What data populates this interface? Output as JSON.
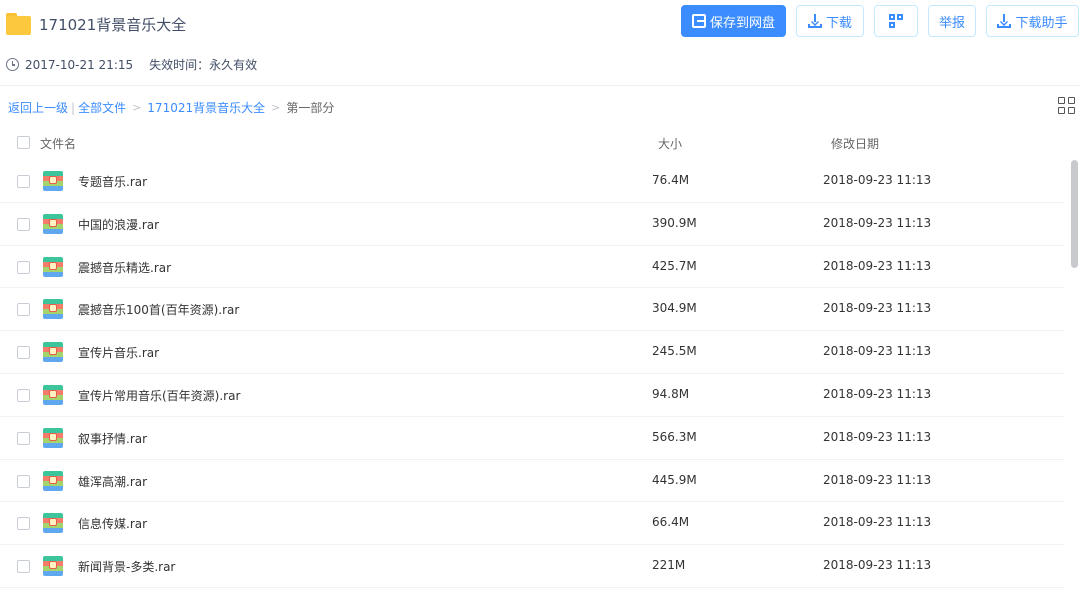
{
  "header": {
    "title": "171021背景音乐大全",
    "created_time": "2017-10-21 21:15",
    "expiry_label": "失效时间：永久有效",
    "buttons": {
      "save": "保存到网盘",
      "download": "下载",
      "report": "举报",
      "helper": "下载助手"
    },
    "accent_color": "#3b8cff"
  },
  "breadcrumb": {
    "back": "返回上一级",
    "separator": "|",
    "items": [
      "全部文件",
      "171021背景音乐大全"
    ],
    "current": "第一部分"
  },
  "table": {
    "columns": [
      "文件名",
      "大小",
      "修改日期"
    ],
    "rows": [
      {
        "name": "专题音乐.rar",
        "size": "76.4M",
        "date": "2018-09-23 11:13"
      },
      {
        "name": "中国的浪漫.rar",
        "size": "390.9M",
        "date": "2018-09-23 11:13"
      },
      {
        "name": "震撼音乐精选.rar",
        "size": "425.7M",
        "date": "2018-09-23 11:13"
      },
      {
        "name": "震撼音乐100首(百年资源).rar",
        "size": "304.9M",
        "date": "2018-09-23 11:13"
      },
      {
        "name": "宣传片音乐.rar",
        "size": "245.5M",
        "date": "2018-09-23 11:13"
      },
      {
        "name": "宣传片常用音乐(百年资源).rar",
        "size": "94.8M",
        "date": "2018-09-23 11:13"
      },
      {
        "name": "叙事抒情.rar",
        "size": "566.3M",
        "date": "2018-09-23 11:13"
      },
      {
        "name": "雄浑高潮.rar",
        "size": "445.9M",
        "date": "2018-09-23 11:13"
      },
      {
        "name": "信息传媒.rar",
        "size": "66.4M",
        "date": "2018-09-23 11:13"
      },
      {
        "name": "新闻背景-多类.rar",
        "size": "221M",
        "date": "2018-09-23 11:13"
      }
    ]
  },
  "icons": {
    "folder": "folder-icon",
    "clock": "clock-icon",
    "file": "rar-archive-icon",
    "view_toggle": "grid-view-icon"
  }
}
